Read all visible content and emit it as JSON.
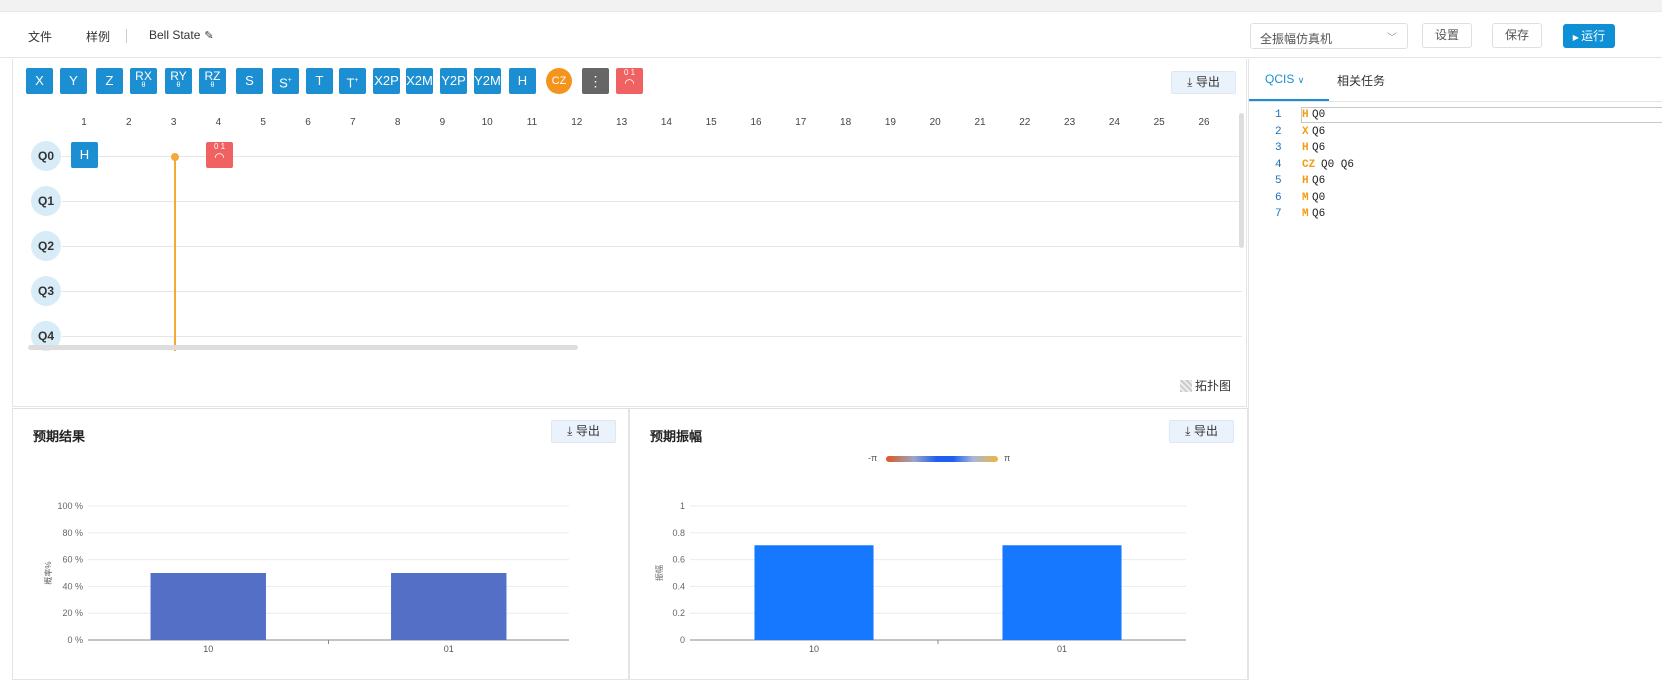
{
  "menu": {
    "file": "文件",
    "samples": "样例",
    "project_name": "Bell State",
    "edit_icon": "pencil-icon"
  },
  "toolbar": {
    "simulator": "全振幅仿真机",
    "settings": "设置",
    "save": "保存",
    "run": "运行"
  },
  "palette": {
    "gates": [
      {
        "label": "X"
      },
      {
        "label": "Y"
      },
      {
        "label": "Z"
      },
      {
        "label": "RX",
        "sub": "θ"
      },
      {
        "label": "RY",
        "sub": "θ"
      },
      {
        "label": "RZ",
        "sub": "θ"
      },
      {
        "label": "S"
      },
      {
        "label": "S",
        "sup": "+"
      },
      {
        "label": "T"
      },
      {
        "label": "T",
        "sup": "+"
      },
      {
        "label": "X2P"
      },
      {
        "label": "X2M"
      },
      {
        "label": "Y2P"
      },
      {
        "label": "Y2M"
      },
      {
        "label": "H"
      },
      {
        "label": "CZ"
      },
      {
        "label": "⋮"
      },
      {
        "label": "0 1"
      }
    ],
    "export": "导出"
  },
  "circuit": {
    "columns": [
      "1",
      "2",
      "3",
      "4",
      "5",
      "6",
      "7",
      "8",
      "9",
      "10",
      "11",
      "12",
      "13",
      "14",
      "15",
      "16",
      "17",
      "18",
      "19",
      "20",
      "21",
      "22",
      "23",
      "24",
      "25",
      "26"
    ],
    "qubits": [
      "Q0",
      "Q1",
      "Q2",
      "Q3",
      "Q4"
    ],
    "placed_gates": {
      "h": "H",
      "measure": "0 1"
    },
    "topology": "拓扑图"
  },
  "colors": {
    "accent": "#1b8fd1",
    "cz": "#f5941d",
    "measure": "#f06262",
    "bar_prob": "#5470c6",
    "bar_amp": "#1677ff"
  },
  "probability_panel": {
    "title": "预期结果",
    "export": "导出"
  },
  "amplitude_panel": {
    "title": "预期振幅",
    "export": "导出",
    "phase_min": "-π",
    "phase_max": "π"
  },
  "chart_data": [
    {
      "type": "bar",
      "title": "预期结果",
      "categories": [
        "10",
        "01"
      ],
      "values": [
        50,
        50
      ],
      "ylabel": "概率%",
      "ylim": [
        0,
        100
      ],
      "yticks": [
        "0 %",
        "20 %",
        "40 %",
        "60 %",
        "80 %",
        "100 %"
      ],
      "grid": true
    },
    {
      "type": "bar",
      "title": "预期振幅",
      "categories": [
        "10",
        "01"
      ],
      "values": [
        0.707,
        0.707
      ],
      "ylabel": "振幅",
      "ylim": [
        0,
        1
      ],
      "yticks": [
        "0",
        "0.2",
        "0.4",
        "0.6",
        "0.8",
        "1"
      ],
      "grid": true
    }
  ],
  "right_panel": {
    "tabs": [
      "QCIS",
      "相关任务"
    ],
    "code": [
      {
        "n": "1",
        "op": "H",
        "args": "Q0"
      },
      {
        "n": "2",
        "op": "X",
        "args": "Q6"
      },
      {
        "n": "3",
        "op": "H",
        "args": "Q6"
      },
      {
        "n": "4",
        "op": "CZ",
        "args": "Q0 Q6"
      },
      {
        "n": "5",
        "op": "H",
        "args": "Q6"
      },
      {
        "n": "6",
        "op": "M",
        "args": "Q0"
      },
      {
        "n": "7",
        "op": "M",
        "args": "Q6"
      }
    ]
  }
}
